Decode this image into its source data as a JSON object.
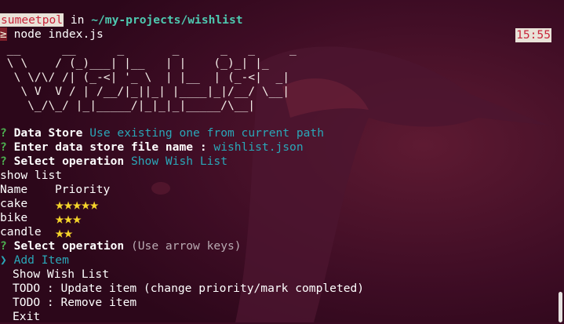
{
  "prompt": {
    "user": "sumeetpol",
    "in_word": " in ",
    "path": "~/my-projects/wishlist",
    "symbol": "≥",
    "command": " node index.js",
    "time": "15:55"
  },
  "ascii_art": [
    " __      __      _       _      _   _     _",
    " \\ \\    / (_)___| |__   | |    (_)_| |_  ",
    "  \\ \\/\\/ /| (_-<| '_ \\  | |__  | (_-<|  _|",
    "   \\ V  V / | /__/|_||_| |____|_|/__/ \\__|",
    "    \\_/\\_/ |_|_____/|_|_|_|_____/\\__|"
  ],
  "questions": [
    {
      "mark": "?",
      "label": "Data Store",
      "answer": "Use existing one from current path"
    },
    {
      "mark": "?",
      "label": "Enter data store file name :",
      "answer": "wishlist.json"
    },
    {
      "mark": "?",
      "label": "Select operation",
      "answer": "Show Wish List"
    }
  ],
  "output": {
    "heading": "show list",
    "col_name": "Name",
    "col_priority": "Priority",
    "items": [
      {
        "name": "cake",
        "stars": "★★★★★"
      },
      {
        "name": "bike",
        "stars": "★★★"
      },
      {
        "name": "candle",
        "stars": "★★"
      }
    ]
  },
  "menu": {
    "mark": "?",
    "label": "Select operation",
    "hint": "(Use arrow keys)",
    "pointer": "❯",
    "options": [
      "Add Item",
      "Show Wish List",
      "TODO : Update item (change priority/mark completed)",
      "TODO : Remove item",
      "Exit"
    ],
    "selected_index": 0
  },
  "colors": {
    "background": "#3a0a22",
    "accent_cyan": "#2aa7b8",
    "question_green": "#4caf50",
    "star_yellow": "#f5d42a"
  }
}
